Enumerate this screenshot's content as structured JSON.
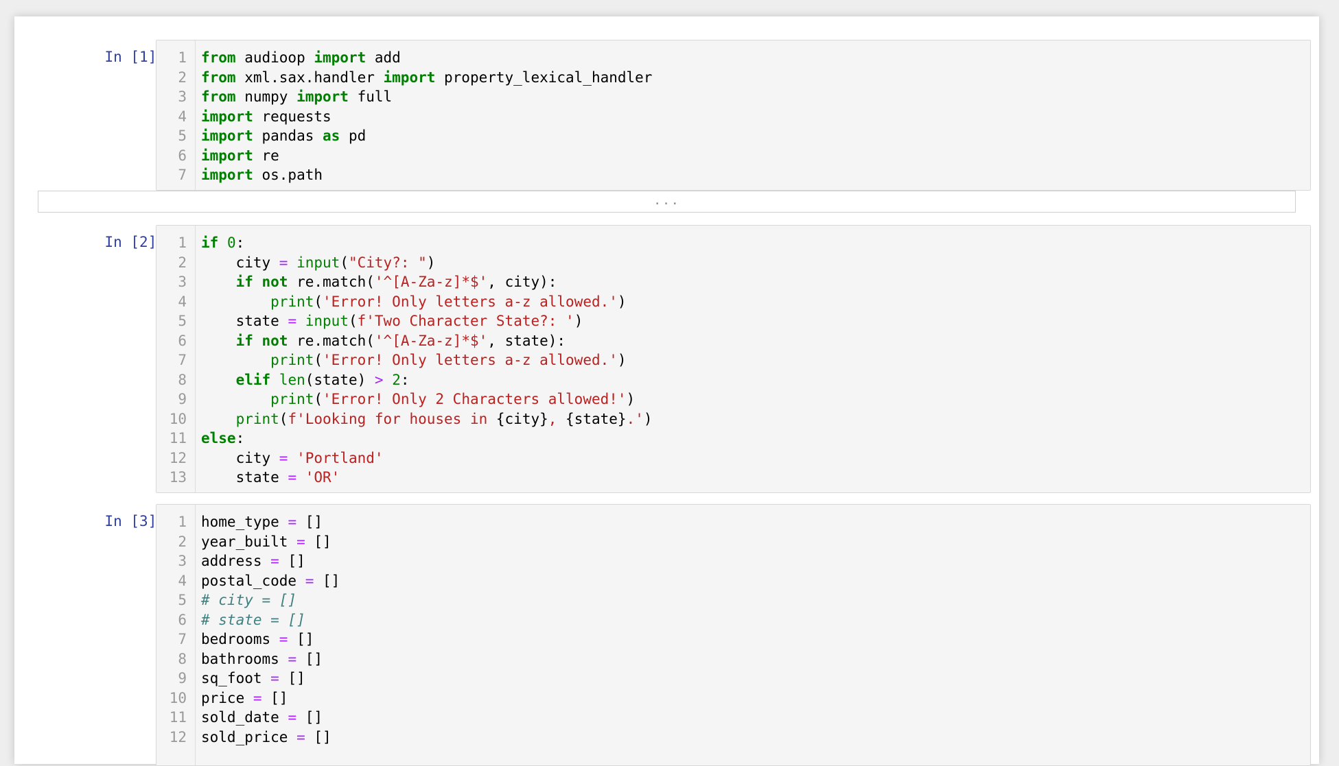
{
  "notebook": {
    "cells": [
      {
        "prompt": "In [1]:",
        "lines": [
          [
            [
              "from",
              "kw"
            ],
            [
              " audioop ",
              ""
            ],
            [
              "import",
              "kw"
            ],
            [
              " add",
              ""
            ]
          ],
          [
            [
              "from",
              "kw"
            ],
            [
              " xml.sax.handler ",
              ""
            ],
            [
              "import",
              "kw"
            ],
            [
              " property_lexical_handler",
              ""
            ]
          ],
          [
            [
              "from",
              "kw"
            ],
            [
              " numpy ",
              ""
            ],
            [
              "import",
              "kw"
            ],
            [
              " full",
              ""
            ]
          ],
          [
            [
              "import",
              "kw"
            ],
            [
              " requests",
              ""
            ]
          ],
          [
            [
              "import",
              "kw"
            ],
            [
              " pandas ",
              ""
            ],
            [
              "as",
              "kw"
            ],
            [
              " pd",
              ""
            ]
          ],
          [
            [
              "import",
              "kw"
            ],
            [
              " re",
              ""
            ]
          ],
          [
            [
              "import",
              "kw"
            ],
            [
              " os.path",
              ""
            ]
          ]
        ]
      },
      {
        "prompt": "In [2]:",
        "lines": [
          [
            [
              "if",
              "kw"
            ],
            [
              " ",
              ""
            ],
            [
              "0",
              "nm"
            ],
            [
              ":",
              ""
            ]
          ],
          [
            [
              "    city ",
              ""
            ],
            [
              "=",
              "op"
            ],
            [
              " ",
              ""
            ],
            [
              "input",
              "bi"
            ],
            [
              "(",
              ""
            ],
            [
              "\"City?: \"",
              "st"
            ],
            [
              ")",
              ""
            ]
          ],
          [
            [
              "    ",
              ""
            ],
            [
              "if",
              "kw"
            ],
            [
              " ",
              ""
            ],
            [
              "not",
              "kw"
            ],
            [
              " re.match(",
              ""
            ],
            [
              "'^[A-Za-z]*$'",
              "st"
            ],
            [
              ", city):",
              ""
            ]
          ],
          [
            [
              "        ",
              ""
            ],
            [
              "print",
              "bi"
            ],
            [
              "(",
              ""
            ],
            [
              "'Error! Only letters a-z allowed.'",
              "st"
            ],
            [
              ")",
              ""
            ]
          ],
          [
            [
              "    state ",
              ""
            ],
            [
              "=",
              "op"
            ],
            [
              " ",
              ""
            ],
            [
              "input",
              "bi"
            ],
            [
              "(",
              ""
            ],
            [
              "f'Two Character State?: '",
              "st"
            ],
            [
              ")",
              ""
            ]
          ],
          [
            [
              "    ",
              ""
            ],
            [
              "if",
              "kw"
            ],
            [
              " ",
              ""
            ],
            [
              "not",
              "kw"
            ],
            [
              " re.match(",
              ""
            ],
            [
              "'^[A-Za-z]*$'",
              "st"
            ],
            [
              ", state):",
              ""
            ]
          ],
          [
            [
              "        ",
              ""
            ],
            [
              "print",
              "bi"
            ],
            [
              "(",
              ""
            ],
            [
              "'Error! Only letters a-z allowed.'",
              "st"
            ],
            [
              ")",
              ""
            ]
          ],
          [
            [
              "    ",
              ""
            ],
            [
              "elif",
              "kw"
            ],
            [
              " ",
              ""
            ],
            [
              "len",
              "bi"
            ],
            [
              "(state) ",
              ""
            ],
            [
              ">",
              "op"
            ],
            [
              " ",
              ""
            ],
            [
              "2",
              "nm"
            ],
            [
              ":",
              ""
            ]
          ],
          [
            [
              "        ",
              ""
            ],
            [
              "print",
              "bi"
            ],
            [
              "(",
              ""
            ],
            [
              "'Error! Only 2 Characters allowed!'",
              "st"
            ],
            [
              ")",
              ""
            ]
          ],
          [
            [
              "    ",
              ""
            ],
            [
              "print",
              "bi"
            ],
            [
              "(",
              ""
            ],
            [
              "f'Looking for houses in ",
              "st"
            ],
            [
              "{city}",
              ""
            ],
            [
              ", ",
              "st"
            ],
            [
              "{state}",
              ""
            ],
            [
              ".'",
              "st"
            ],
            [
              ")",
              ""
            ]
          ],
          [
            [
              "else",
              "kw"
            ],
            [
              ":",
              ""
            ]
          ],
          [
            [
              "    city ",
              ""
            ],
            [
              "=",
              "op"
            ],
            [
              " ",
              ""
            ],
            [
              "'Portland'",
              "st"
            ]
          ],
          [
            [
              "    state ",
              ""
            ],
            [
              "=",
              "op"
            ],
            [
              " ",
              ""
            ],
            [
              "'OR'",
              "st"
            ]
          ]
        ]
      },
      {
        "prompt": "In [3]:",
        "lines": [
          [
            [
              "home_type ",
              ""
            ],
            [
              "=",
              "op"
            ],
            [
              " []",
              ""
            ]
          ],
          [
            [
              "year_built ",
              ""
            ],
            [
              "=",
              "op"
            ],
            [
              " []",
              ""
            ]
          ],
          [
            [
              "address ",
              ""
            ],
            [
              "=",
              "op"
            ],
            [
              " []",
              ""
            ]
          ],
          [
            [
              "postal_code ",
              ""
            ],
            [
              "=",
              "op"
            ],
            [
              " []",
              ""
            ]
          ],
          [
            [
              "# city = []",
              "cm"
            ]
          ],
          [
            [
              "# state = []",
              "cm"
            ]
          ],
          [
            [
              "bedrooms ",
              ""
            ],
            [
              "=",
              "op"
            ],
            [
              " []",
              ""
            ]
          ],
          [
            [
              "bathrooms ",
              ""
            ],
            [
              "=",
              "op"
            ],
            [
              " []",
              ""
            ]
          ],
          [
            [
              "sq_foot ",
              ""
            ],
            [
              "=",
              "op"
            ],
            [
              " []",
              ""
            ]
          ],
          [
            [
              "price ",
              ""
            ],
            [
              "=",
              "op"
            ],
            [
              " []",
              ""
            ]
          ],
          [
            [
              "sold_date ",
              ""
            ],
            [
              "=",
              "op"
            ],
            [
              " []",
              ""
            ]
          ],
          [
            [
              "sold_price ",
              ""
            ],
            [
              "=",
              "op"
            ],
            [
              " []",
              ""
            ]
          ]
        ]
      }
    ],
    "collapsed_output": "..."
  }
}
